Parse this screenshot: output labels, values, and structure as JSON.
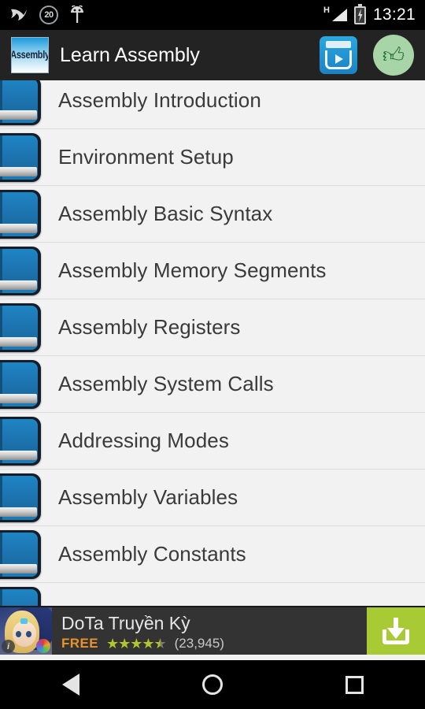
{
  "status_bar": {
    "icons_left": [
      "swallow-icon",
      "notification-count-badge",
      "android-head-icon"
    ],
    "notification_count": "20",
    "network_type": "H",
    "icons_right": [
      "signal-icon",
      "battery-charging-icon"
    ],
    "time": "13:21"
  },
  "app_bar": {
    "app_icon_label": "Assembly",
    "title": "Learn Assembly",
    "actions": [
      {
        "name": "play-store-icon",
        "label": "More Apps"
      },
      {
        "name": "thumbs-up-icon",
        "label": "Rate App"
      }
    ]
  },
  "list": {
    "items": [
      {
        "label": "Assembly Introduction"
      },
      {
        "label": "Environment Setup"
      },
      {
        "label": "Assembly Basic Syntax"
      },
      {
        "label": "Assembly Memory Segments"
      },
      {
        "label": "Assembly Registers"
      },
      {
        "label": "Assembly System Calls"
      },
      {
        "label": "Addressing Modes"
      },
      {
        "label": "Assembly Variables"
      },
      {
        "label": "Assembly Constants"
      },
      {
        "label": ""
      }
    ]
  },
  "ad": {
    "title": "DoTa Truyền Kỳ",
    "price": "FREE",
    "rating": 4.5,
    "stars_full": "★★★★",
    "star_half": "★",
    "review_count": "(23,945)",
    "info_badge": "i",
    "cta": "download-icon",
    "cta_color": "#a8ca35"
  },
  "nav_bar": {
    "buttons": [
      {
        "name": "back-button",
        "label": "Back"
      },
      {
        "name": "home-button",
        "label": "Home"
      },
      {
        "name": "recents-button",
        "label": "Recents"
      }
    ]
  },
  "colors": {
    "status_bar_bg": "#000000",
    "app_bar_bg": "#232323",
    "list_bg": "#f2f2f2",
    "list_text": "#3a3a3a",
    "accent_green": "#a8ca35",
    "free_orange": "#e8922c"
  }
}
